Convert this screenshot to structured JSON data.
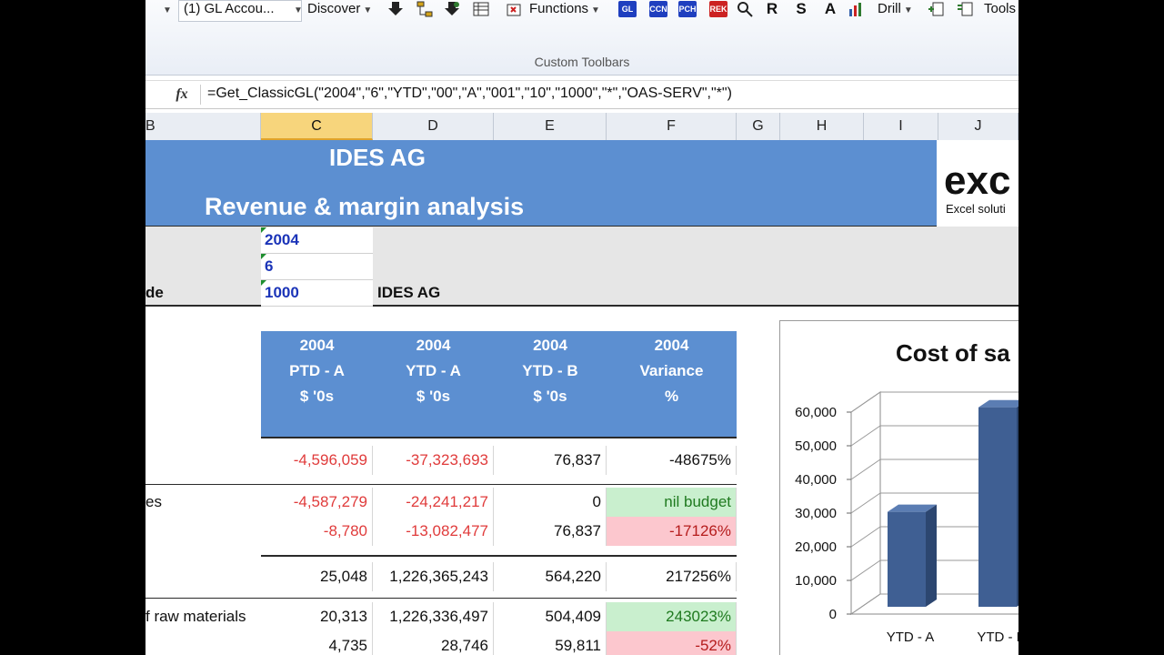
{
  "toolbar": {
    "dropdown_account": "(1)  GL Accou...",
    "discover_label": "Discover",
    "functions_label": "Functions",
    "drill_label": "Drill",
    "tools_label": "Tools",
    "group_label": "Custom Toolbars",
    "icon_badges": [
      "GL",
      "CCN",
      "PCH",
      "REK"
    ],
    "letter_icons": [
      "R",
      "S",
      "A"
    ]
  },
  "formula_bar": {
    "fx_label": "fx",
    "formula": "=Get_ClassicGL(\"2004\",\"6\",\"YTD\",\"00\",\"A\",\"001\",\"10\",\"1000\",\"*\",\"OAS-SERV\",\"*\")"
  },
  "columns": [
    "B",
    "C",
    "D",
    "E",
    "F",
    "G",
    "H",
    "I",
    "J"
  ],
  "sheet": {
    "company": "IDES AG",
    "subtitle": "Revenue & margin analysis",
    "logo_text": "exc",
    "logo_subtext": "Excel soluti",
    "params": {
      "year": "2004",
      "period": "6",
      "code_label": "de",
      "code": "1000",
      "code_name": "IDES AG"
    }
  },
  "table": {
    "headers": [
      {
        "l1": "2004",
        "l2": "PTD - A",
        "l3": "$ '0s"
      },
      {
        "l1": "2004",
        "l2": "YTD - A",
        "l3": "$ '0s"
      },
      {
        "l1": "2004",
        "l2": "YTD - B",
        "l3": "$ '0s"
      },
      {
        "l1": "2004",
        "l2": "Variance",
        "l3": "%"
      }
    ],
    "rows": [
      {
        "label": "",
        "c": "-4,596,059",
        "d": "-37,323,693",
        "e": "76,837",
        "f": "-48675%"
      },
      {
        "label": "es",
        "c": "-4,587,279",
        "d": "-24,241,217",
        "e": "0",
        "f": "nil budget"
      },
      {
        "label": "",
        "c": "-8,780",
        "d": "-13,082,477",
        "e": "76,837",
        "f": "-17126%"
      },
      {
        "label": "",
        "c": "25,048",
        "d": "1,226,365,243",
        "e": "564,220",
        "f": "217256%"
      },
      {
        "label": "f raw materials",
        "c": "20,313",
        "d": "1,226,336,497",
        "e": "504,409",
        "f": "243023%"
      },
      {
        "label": "",
        "c": "4,735",
        "d": "28,746",
        "e": "59,811",
        "f": "-52%"
      }
    ]
  },
  "chart_data": {
    "type": "bar",
    "title": "Cost of sa",
    "categories": [
      "YTD - A",
      "YTD - B"
    ],
    "values": [
      28746,
      59811
    ],
    "yticks": [
      "0",
      "10,000",
      "20,000",
      "30,000",
      "40,000",
      "50,000",
      "60,000"
    ],
    "ylim": [
      0,
      60000
    ],
    "bar_color": "#3f5f93"
  },
  "colors": {
    "header_blue": "#5c8fd1",
    "negative_red": "#e03b3b",
    "good_green_bg": "#c9efce",
    "bad_pink_bg": "#fcc7ce",
    "input_blue": "#1b34b8"
  }
}
